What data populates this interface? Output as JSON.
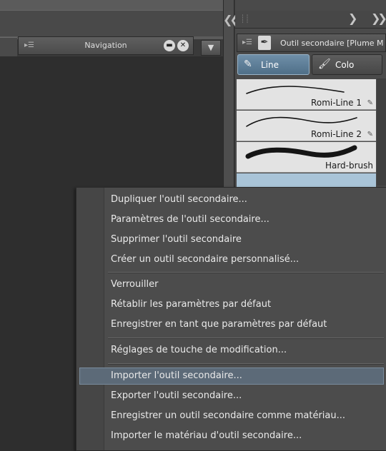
{
  "navigation_panel": {
    "title": "Navigation",
    "minimize_icon": "minimize-circle-icon",
    "close_icon": "close-circle-icon",
    "menu_icon": "panel-menu-icon"
  },
  "right_panel": {
    "collapse_icon": "double-chevron-left-icon",
    "next_icon": "chevron-right-icon",
    "expand_icon": "double-chevron-right-icon",
    "subtool_header": "Outil secondaire [Plume M",
    "tool_icon": "pen-nib-icon",
    "groups": [
      {
        "label": "Line",
        "icon": "pen-line-icon",
        "active": true
      },
      {
        "label": "Colo",
        "icon": "color-brush-icon",
        "active": false
      }
    ],
    "brushes": [
      {
        "name": "Romi-Line 1",
        "edit_icon": "pencil-icon"
      },
      {
        "name": "Romi-Line 2",
        "edit_icon": "pencil-icon"
      },
      {
        "name": "Hard-brush"
      }
    ]
  },
  "context_menu": {
    "items": [
      "Dupliquer l'outil secondaire...",
      "Paramètres de l'outil secondaire...",
      "Supprimer l'outil secondaire",
      "Créer un outil secondaire personnalisé...",
      "Verrouiller",
      "Rétablir les paramètres par défaut",
      "Enregistrer en tant que paramètres par défaut",
      "Réglages de touche de modification...",
      "Importer l'outil secondaire...",
      "Exporter l'outil secondaire...",
      "Enregistrer un outil secondaire comme matériau...",
      "Importer le matériau d'outil secondaire..."
    ],
    "highlighted_index": 8
  },
  "colors": {
    "menu_background": "#4c4c4c",
    "menu_highlight": "#5c6a78",
    "active_group": "#5f7f99",
    "canvas": "#2e2e2e"
  }
}
